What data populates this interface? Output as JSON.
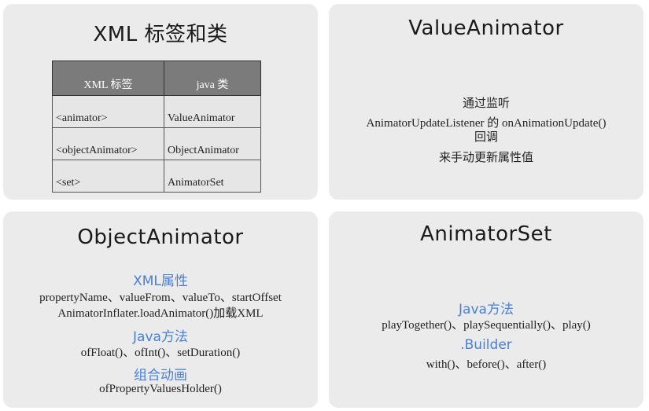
{
  "xml_panel": {
    "title": "XML 标签和类",
    "table": {
      "headers": [
        "XML 标签",
        "java 类"
      ],
      "rows": [
        [
          "<animator>",
          "ValueAnimator"
        ],
        [
          "<objectAnimator>",
          "ObjectAnimator"
        ],
        [
          "<set>",
          "AnimatorSet"
        ]
      ]
    }
  },
  "value_animator_panel": {
    "title": "ValueAnimator",
    "lines": [
      "通过监听",
      "AnimatorUpdateListener 的 onAnimationUpdate()",
      "回调",
      "来手动更新属性值"
    ]
  },
  "object_animator_panel": {
    "title": "ObjectAnimator",
    "sections": [
      {
        "heading": "XML属性",
        "lines": [
          "propertyName、valueFrom、valueTo、startOffset",
          "AnimatorInflater.loadAnimator()加载XML"
        ]
      },
      {
        "heading": "Java方法",
        "lines": [
          "ofFloat()、ofInt()、setDuration()"
        ]
      },
      {
        "heading": "组合动画",
        "lines": [
          "ofPropertyValuesHolder()"
        ]
      }
    ]
  },
  "animator_set_panel": {
    "title": "AnimatorSet",
    "sections": [
      {
        "heading": "Java方法",
        "lines": [
          "playTogether()、playSequentially()、play()"
        ]
      },
      {
        "heading": ".Builder",
        "lines": [
          "with()、before()、after()"
        ]
      }
    ]
  },
  "colors": {
    "panel_bg": "#ebebeb",
    "table_header_bg": "#7b7b7b",
    "heading_blue": "#4a7fd6"
  }
}
